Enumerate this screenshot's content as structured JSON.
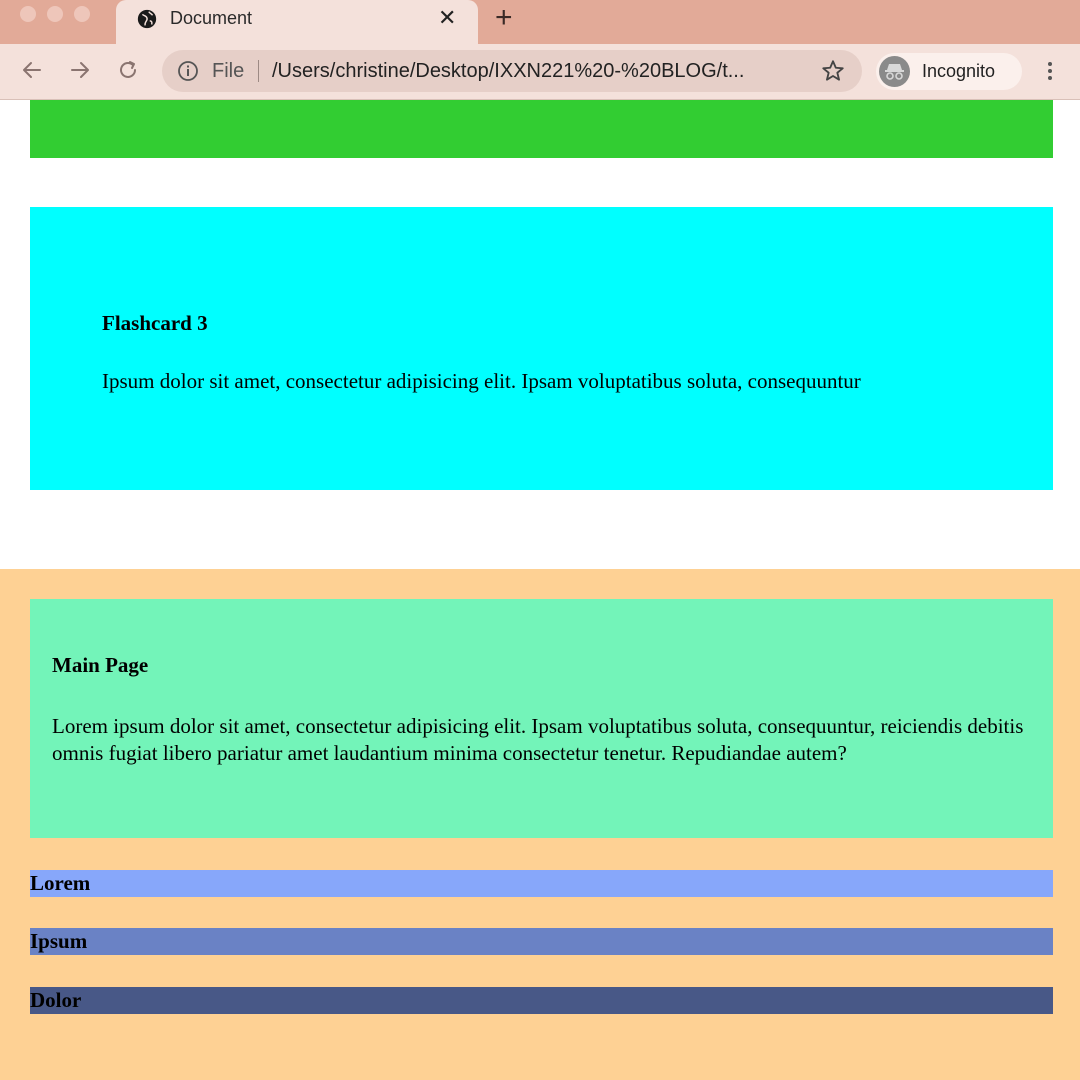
{
  "browser": {
    "tab_title": "Document",
    "tab_close_glyph": "✕",
    "new_tab_glyph": "+",
    "scheme_label": "File",
    "url": "/Users/christine/Desktop/IXXN221%20-%20BLOG/t...",
    "profile_label": "Incognito",
    "icons": [
      "back-arrow-icon",
      "forward-arrow-icon",
      "reload-icon",
      "info-icon",
      "star-icon",
      "incognito-icon",
      "kebab-menu-icon",
      "globe-icon"
    ]
  },
  "page": {
    "flashcard": {
      "title": "Flashcard 3",
      "body": "Ipsum dolor sit amet, consectetur adipisicing elit. Ipsam voluptatibus soluta, consequuntur"
    },
    "main_card": {
      "title": "Main Page",
      "body": "Lorem ipsum dolor sit amet, consectetur adipisicing elit. Ipsam voluptatibus soluta, consequuntur, reiciendis debitis omnis fugiat libero pariatur amet laudantium minima consectetur tenetur. Repudiandae autem?"
    },
    "strips": [
      "Lorem",
      "Ipsum",
      "Dolor"
    ]
  },
  "colors": {
    "chrome_titlebar": "#e2aa98",
    "chrome_toolbar": "#f4e1db",
    "green_bar": "#32cd32",
    "flashcard_bg": "#00ffff",
    "orange_section": "#fed194",
    "main_card_bg": "#73f4b9",
    "strip_lorem": "#87a7fa",
    "strip_ipsum": "#6a82c5",
    "strip_dolor": "#485887"
  }
}
